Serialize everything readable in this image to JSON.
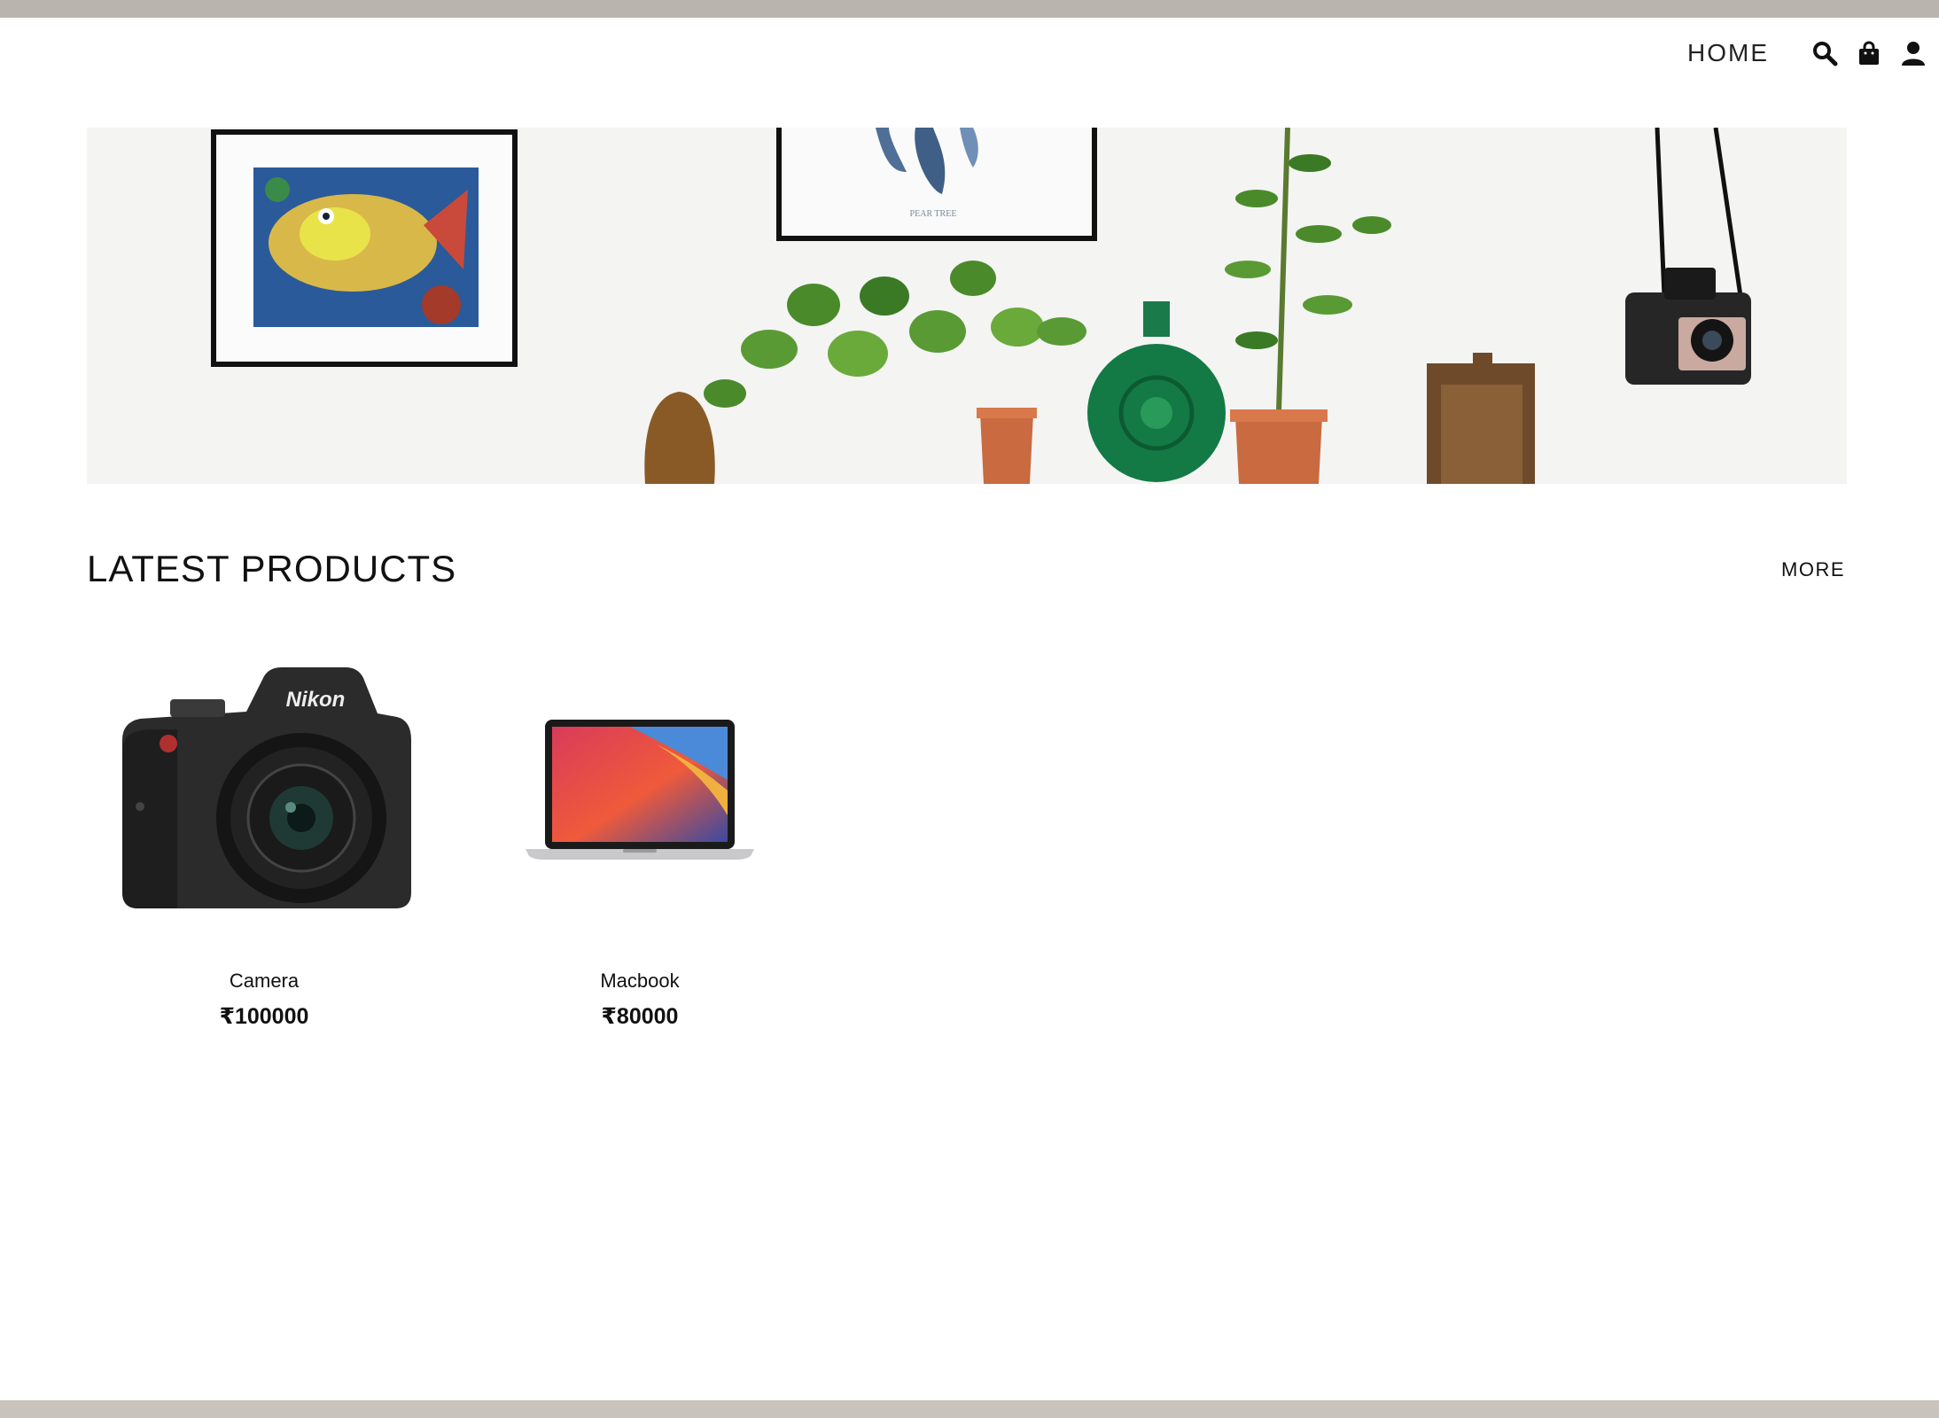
{
  "nav": {
    "home_label": "HOME",
    "icons": [
      "search-icon",
      "shopping-bag-icon",
      "user-icon"
    ]
  },
  "hero": {
    "poster_caption": "PEAR TREE"
  },
  "section": {
    "title": "LATEST PRODUCTS",
    "more_label": "MORE"
  },
  "products": [
    {
      "name": "Camera",
      "price": "₹100000",
      "brand": "Nikon"
    },
    {
      "name": "Macbook",
      "price": "₹80000"
    }
  ],
  "colors": {
    "text": "#111111",
    "frame": "#b9b4ae",
    "background": "#ffffff"
  }
}
